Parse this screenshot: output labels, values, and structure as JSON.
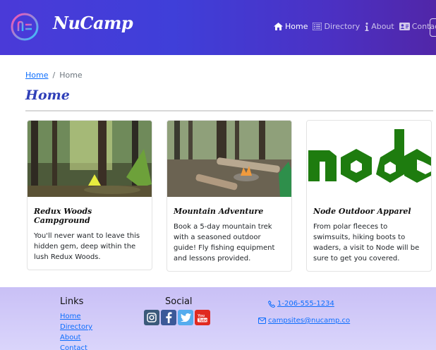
{
  "header": {
    "brand": "NuCamp",
    "nav": [
      {
        "label": "Home",
        "icon": "home-icon",
        "active": true
      },
      {
        "label": "Directory",
        "icon": "list-icon",
        "active": false
      },
      {
        "label": "About",
        "icon": "info-icon",
        "active": false
      },
      {
        "label": "Contact",
        "icon": "address-card-icon",
        "active": false
      }
    ]
  },
  "breadcrumb": {
    "home_link": "Home",
    "separator": "/",
    "current": "Home"
  },
  "page_title": "Home",
  "cards": [
    {
      "title": "Redux Woods Campground",
      "text": "You'll never want to leave this hidden gem, deep within the lush Redux Woods."
    },
    {
      "title": "Mountain Adventure",
      "text": "Book a 5-day mountain trek with a seasoned outdoor guide! Fly fishing equipment and lessons provided."
    },
    {
      "title": "Node Outdoor Apparel",
      "text": "From polar fleeces to swimsuits, hiking boots to waders, a visit to Node will be sure to get you covered."
    }
  ],
  "footer": {
    "links_title": "Links",
    "links": [
      "Home",
      "Directory",
      "About",
      "Contact"
    ],
    "social_title": "Social",
    "social": [
      "instagram-icon",
      "facebook-icon",
      "twitter-icon",
      "youtube-icon"
    ],
    "phone": "1-206-555-1234",
    "email": "campsites@nucamp.co"
  },
  "colors": {
    "header_start": "#4a3ad8",
    "header_end": "#5126a8",
    "title": "#2f3fb8",
    "link": "#0d6efd",
    "footer": "#c9c0f6"
  }
}
